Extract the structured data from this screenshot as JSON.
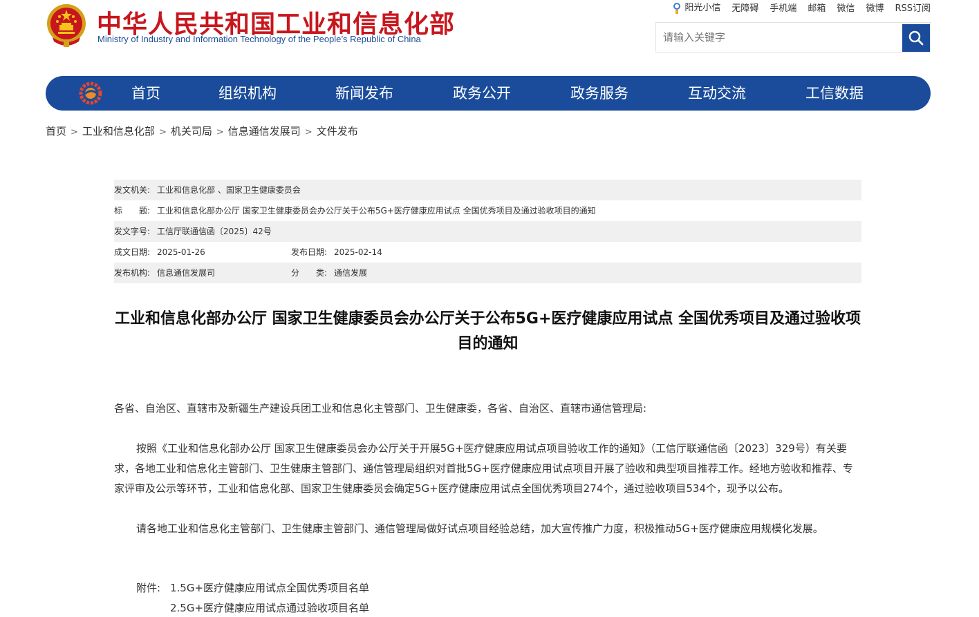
{
  "header": {
    "title": "中华人民共和国工业和信息化部",
    "subtitle": "Ministry of Industry and Information Technology of the People’s Republic of China",
    "toplinks": [
      "阳光小信",
      "无障碍",
      "手机端",
      "邮箱",
      "微信",
      "微博",
      "RSS订阅"
    ],
    "search_placeholder": "请输入关键字"
  },
  "nav": {
    "items": [
      "首页",
      "组织机构",
      "新闻发布",
      "政务公开",
      "政务服务",
      "互动交流",
      "工信数据"
    ]
  },
  "breadcrumb": [
    "首页",
    "工业和信息化部",
    "机关司局",
    "信息通信发展司",
    "文件发布"
  ],
  "meta": {
    "issuer_label": "发文机关:",
    "issuer": "工业和信息化部 、国家卫生健康委员会",
    "title_label": "标　　题:",
    "title": "工业和信息化部办公厅 国家卫生健康委员会办公厅关于公布5G+医疗健康应用试点 全国优秀项目及通过验收项目的通知",
    "doc_no_label": "发文字号:",
    "doc_no": "工信厅联通信函〔2025〕42号",
    "written_label": "成文日期:",
    "written": "2025-01-26",
    "published_label": "发布日期:",
    "published": "2025-02-14",
    "org_label": "发布机构:",
    "org": "信息通信发展司",
    "category_label": "分　　类:",
    "category": "通信发展"
  },
  "article": {
    "title": "工业和信息化部办公厅 国家卫生健康委员会办公厅关于公布5G+医疗健康应用试点 全国优秀项目及通过验收项目的通知",
    "salutation": "各省、自治区、直辖市及新疆生产建设兵团工业和信息化主管部门、卫生健康委，各省、自治区、直辖市通信管理局:",
    "para1": "按照《工业和信息化部办公厅 国家卫生健康委员会办公厅关于开展5G+医疗健康应用试点项目验收工作的通知》（工信厅联通信函〔2023〕329号）有关要求，各地工业和信息化主管部门、卫生健康主管部门、通信管理局组织对首批5G+医疗健康应用试点项目开展了验收和典型项目推荐工作。经地方验收和推荐、专家评审及公示等环节，工业和信息化部、国家卫生健康委员会确定5G+医疗健康应用试点全国优秀项目274个，通过验收项目534个，现予以公布。",
    "para2": "请各地工业和信息化主管部门、卫生健康主管部门、通信管理局做好试点项目经验总结，加大宣传推广力度，积极推动5G+医疗健康应用规模化发展。",
    "attach_label": "附件:",
    "attachments": [
      "1.5G+医疗健康应用试点全国优秀项目名单",
      "2.5G+医疗健康应用试点通过验收项目名单"
    ]
  },
  "colors": {
    "brand_red": "#c8161d",
    "brand_blue": "#1a4c9b"
  }
}
